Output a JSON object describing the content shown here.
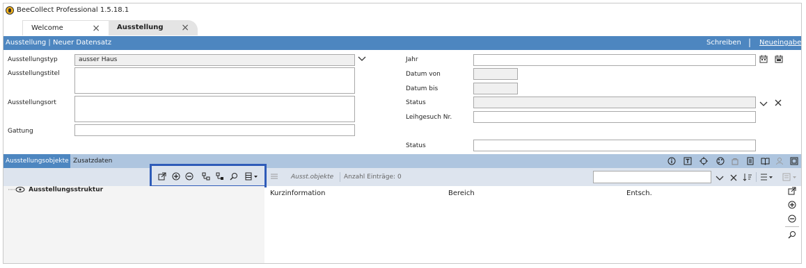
{
  "window": {
    "title": "BeeCollect Professional 1.5.18.1"
  },
  "tabs": [
    {
      "label": "Welcome",
      "close": "×"
    },
    {
      "label": "Ausstellung",
      "close": "×"
    }
  ],
  "header": {
    "left": "Ausstellung | Neuer Datensatz",
    "schreiben": "Schreiben",
    "sep": "|",
    "neueingabe": "Neueingabe"
  },
  "form": {
    "ausstellungstyp_label": "Ausstellungstyp",
    "ausstellungstyp_value": "ausser Haus",
    "ausstellungstitel_label": "Ausstellungstitel",
    "ausstellungsort_label": "Ausstellungsort",
    "gattung_label": "Gattung",
    "jahr_label": "Jahr",
    "datum_von_label": "Datum von",
    "datum_bis_label": "Datum bis",
    "status_label": "Status",
    "leihgesuch_label": "Leihgesuch Nr.",
    "status2_label": "Status"
  },
  "subtabs": [
    {
      "label": "Ausstellungsobjekte"
    },
    {
      "label": "Zusatzdaten"
    }
  ],
  "list_toolbar": {
    "view_label": "Ausst.objekte",
    "count_label": "Anzahl Einträge: 0"
  },
  "tree": {
    "root_label": "Ausstellungsstruktur"
  },
  "grid": {
    "columns": [
      "Kurzinformation",
      "Bereich",
      "Entsch."
    ]
  },
  "colors": {
    "accent": "#4d86c0",
    "tab_bar": "#aec5df",
    "highlight": "#2e5bb8"
  }
}
